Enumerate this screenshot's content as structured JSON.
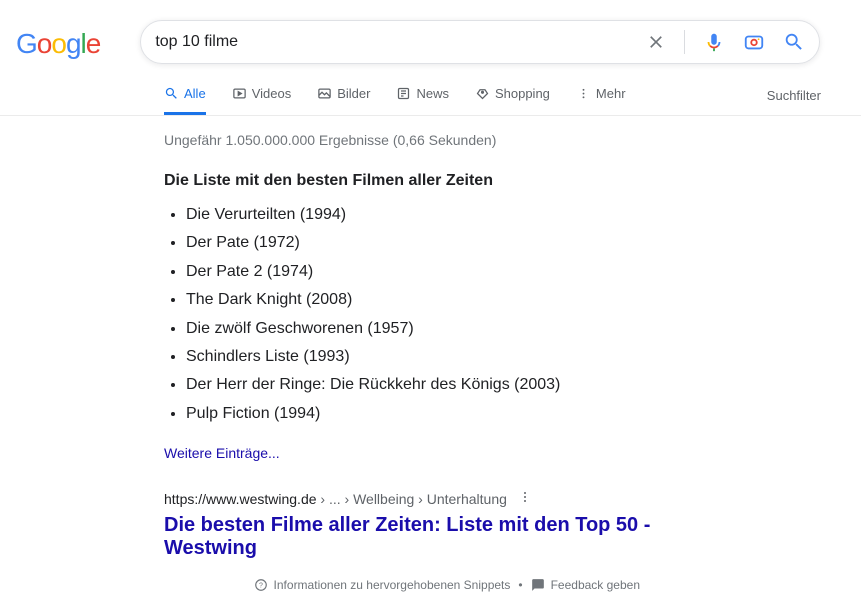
{
  "search": {
    "query": "top 10 filme"
  },
  "tabs": {
    "alle": "Alle",
    "videos": "Videos",
    "bilder": "Bilder",
    "news": "News",
    "shopping": "Shopping",
    "mehr": "Mehr",
    "suchfilter": "Suchfilter"
  },
  "stats": "Ungefähr 1.050.000.000 Ergebnisse (0,66 Sekunden)",
  "snippet": {
    "title": "Die Liste mit den besten Filmen aller Zeiten",
    "items": [
      "Die Verurteilten (1994)",
      "Der Pate (1972)",
      "Der Pate 2 (1974)",
      "The Dark Knight (2008)",
      "Die zwölf Geschworenen (1957)",
      "Schindlers Liste (1993)",
      "Der Herr der Ringe: Die Rückkehr des Königs (2003)",
      "Pulp Fiction (1994)"
    ],
    "more": "Weitere Einträge..."
  },
  "result": {
    "url": "https://www.westwing.de",
    "crumbs": " › ... › Wellbeing › Unterhaltung",
    "title": "Die besten Filme aller Zeiten: Liste mit den Top 50 - Westwing"
  },
  "feedback": {
    "info": "Informationen zu hervorgehobenen Snippets",
    "give": "Feedback geben"
  }
}
